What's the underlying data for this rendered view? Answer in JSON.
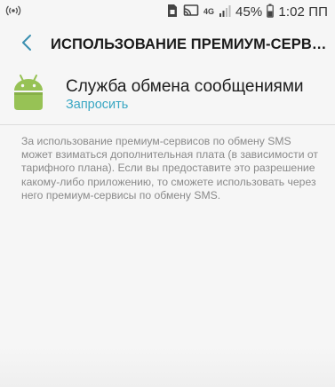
{
  "status_bar": {
    "network": "4G",
    "battery": "45%",
    "time": "1:02 ПП",
    "left_icon": "signal-broadcast-icon",
    "right_icons": [
      "sim-icon",
      "cast-icon",
      "network-type-icon",
      "signal-bars-icon",
      "battery-icon"
    ]
  },
  "app_bar": {
    "title": "ИСПОЛЬЗОВАНИЕ ПРЕМИУМ-СЕРВИСОВ...",
    "back_icon": "back-arrow-icon"
  },
  "app_entry": {
    "name": "Служба обмена сообщениями",
    "action_label": "Запросить",
    "icon": "android-icon"
  },
  "description": "За использование премиум-сервисов по обмену SMS может взиматься дополнительная плата (в зависимости от тарифного плана). Если вы предоставите это разрешение какому-либо приложению, то сможете использовать через него премиум-сервисы по обмену SMS.",
  "colors": {
    "accent": "#3aa7c3",
    "android_green": "#97c255",
    "background": "#f6f6f6",
    "description_text": "#8a8a8a"
  }
}
